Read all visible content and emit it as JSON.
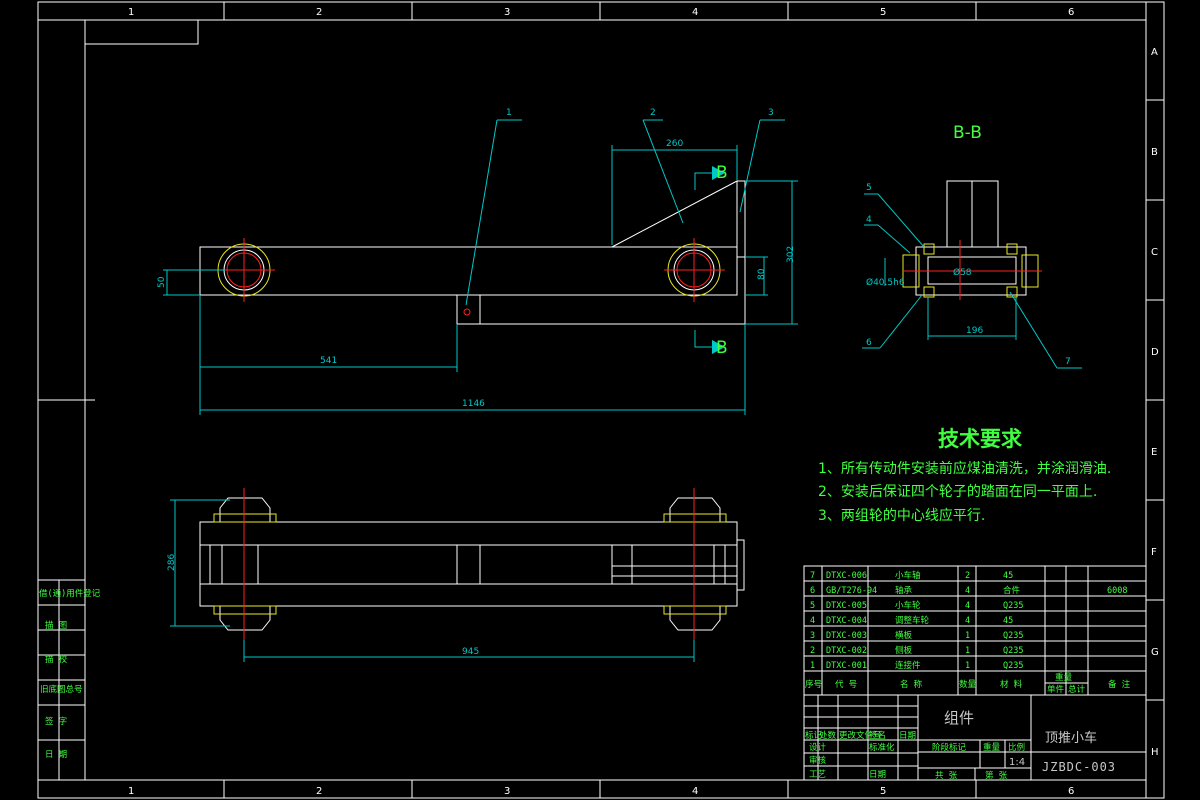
{
  "grid": {
    "columns": [
      "1",
      "2",
      "3",
      "4",
      "5",
      "6"
    ],
    "rows": [
      "A",
      "B",
      "C",
      "D",
      "E",
      "F",
      "G",
      "H"
    ]
  },
  "section_view": {
    "title": "B-B",
    "marker": "B",
    "dim_bearing": "Ø40.5h6",
    "dim_shaft": "Ø58",
    "dim_width": "196",
    "balloons": [
      "5",
      "4",
      "6",
      "7"
    ]
  },
  "front_view": {
    "balloons": [
      "1",
      "2",
      "3"
    ],
    "dims": {
      "top": "260",
      "left": "50",
      "right_small": "80",
      "right_big": "302",
      "mid": "541",
      "overall": "1146"
    }
  },
  "top_view": {
    "dims": {
      "height": "286",
      "width": "945"
    }
  },
  "tech_requirements": {
    "title": "技术要求",
    "items": [
      "1、所有传动件安装前应煤油清洗，并涂润滑油.",
      "2、安装后保证四个轮子的踏面在同一平面上.",
      "3、两组轮的中心线应平行."
    ]
  },
  "bom": {
    "rows": [
      {
        "no": "7",
        "code": "DTXC-006",
        "name": "小车轴",
        "qty": "2",
        "material": "45",
        "note": "",
        "extra": ""
      },
      {
        "no": "6",
        "code": "GB/T276-94",
        "name": "轴承",
        "qty": "4",
        "material": "合件",
        "note": "6008",
        "extra": ""
      },
      {
        "no": "5",
        "code": "DTXC-005",
        "name": "小车轮",
        "qty": "4",
        "material": "Q235",
        "note": "",
        "extra": ""
      },
      {
        "no": "4",
        "code": "DTXC-004",
        "name": "调整车轮",
        "qty": "4",
        "material": "45",
        "note": "",
        "extra": ""
      },
      {
        "no": "3",
        "code": "DTXC-003",
        "name": "横板",
        "qty": "1",
        "material": "Q235",
        "note": "",
        "extra": ""
      },
      {
        "no": "2",
        "code": "DTXC-002",
        "name": "侧板",
        "qty": "1",
        "material": "Q235",
        "note": "",
        "extra": ""
      },
      {
        "no": "1",
        "code": "DTXC-001",
        "name": "连接件",
        "qty": "1",
        "material": "Q235",
        "note": "",
        "extra": ""
      }
    ],
    "headers": [
      "序号",
      "代 号",
      "名 称",
      "数量",
      "材 料",
      "单件",
      "总计",
      "备 注"
    ],
    "weight_header": "重量"
  },
  "title_block": {
    "part_type": "组件",
    "drawing_name": "顶推小车",
    "drawing_no": "JZBDC-003",
    "scale": "1:4",
    "stage_label": "阶段标记",
    "weight_label": "重量",
    "scale_label": "比例",
    "sheet_label": "共 张",
    "sheet_of": "第 张",
    "design": "设计",
    "standardize": "标准化",
    "review": "审核",
    "process": "工艺",
    "approve": "日期",
    "revision_labels": [
      "标记",
      "处数",
      "更改文件号",
      "签名",
      "日期"
    ]
  },
  "side_table": [
    "借(通)用件登记",
    "描 图",
    "描 校",
    "旧底图总号",
    "签 字",
    "日 期"
  ]
}
